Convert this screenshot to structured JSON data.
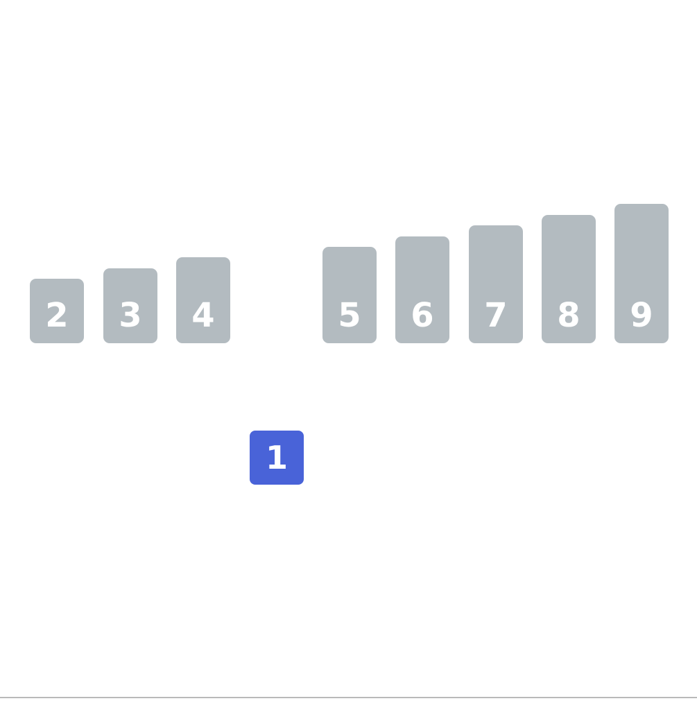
{
  "colors": {
    "bar": "#b3bbc0",
    "active_bar": "#4963d8",
    "bar_text": "#ffffff",
    "background": "#ffffff",
    "divider": "#b9b9b9"
  },
  "bars": [
    {
      "id": "bar-2",
      "label": "2",
      "value": 2,
      "state": "sorted-row"
    },
    {
      "id": "bar-3",
      "label": "3",
      "value": 3,
      "state": "sorted-row"
    },
    {
      "id": "bar-4",
      "label": "4",
      "value": 4,
      "state": "sorted-row"
    },
    {
      "id": "bar-5",
      "label": "5",
      "value": 5,
      "state": "sorted-row"
    },
    {
      "id": "bar-6",
      "label": "6",
      "value": 6,
      "state": "sorted-row"
    },
    {
      "id": "bar-7",
      "label": "7",
      "value": 7,
      "state": "sorted-row"
    },
    {
      "id": "bar-8",
      "label": "8",
      "value": 8,
      "state": "sorted-row"
    },
    {
      "id": "bar-9",
      "label": "9",
      "value": 9,
      "state": "sorted-row"
    }
  ],
  "active_bar": {
    "id": "bar-1",
    "label": "1",
    "value": 1,
    "state": "lifted"
  }
}
